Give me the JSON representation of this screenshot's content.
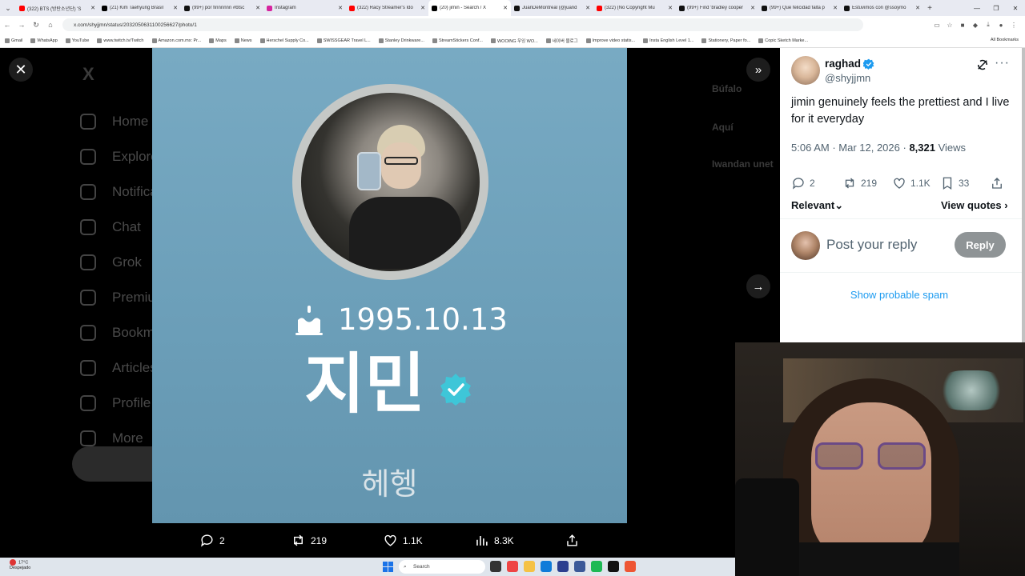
{
  "browser": {
    "tabs": [
      {
        "label": "(322) BTS (방탄소년단) 'S",
        "fav": "#ff0000",
        "active": false
      },
      {
        "label": "(21) Kim Taehyung Brasil",
        "fav": "#000000",
        "active": false
      },
      {
        "label": "(99+) por finnnnnn #btsc",
        "fav": "#111111",
        "active": false
      },
      {
        "label": "Instagram",
        "fav": "#d6249f",
        "active": false
      },
      {
        "label": "(322) Racy Streamer's Ido",
        "fav": "#ff0000",
        "active": false
      },
      {
        "label": "(20) jimin - Search / X",
        "fav": "#000000",
        "active": true
      },
      {
        "label": "JuanDeMontreal (@juand",
        "fav": "#111111",
        "active": false
      },
      {
        "label": "(322) (No Copyright Mu",
        "fav": "#ff0000",
        "active": false
      },
      {
        "label": "(99+) Find 'bradley cooper",
        "fav": "#111111",
        "active": false
      },
      {
        "label": "(99+) Que felicidad falta p",
        "fav": "#111111",
        "active": false
      },
      {
        "label": "Estuvimos con @ssoymo",
        "fav": "#111111",
        "active": false
      }
    ],
    "url": "x.com/shyjjmn/status/2032050631100256627/photo/1",
    "bookmarks": [
      "Gmail",
      "WhatsApp",
      "YouTube",
      "www.twitch.tv/Twitch",
      "Amazon.com.mx: Pr...",
      "Maps",
      "News",
      "Herschel Supply Co...",
      "SWISSGEAR Travel L...",
      "Stanley Drinkware...",
      "StreamStickers Conf...",
      "WOOING 우잉 WO...",
      "네이버 블로그",
      "Improve video statis...",
      "Insta English Level 1...",
      "Stationery, Paper fo...",
      "Copic Sketch Marke..."
    ],
    "all_bookmarks": "All Bookmarks"
  },
  "background_nav": [
    "Home",
    "Explore",
    "Notifications",
    "Chat",
    "Grok",
    "Premium",
    "Bookmarks",
    "Articles",
    "Profile",
    "More"
  ],
  "background_right": [
    "Búfalo",
    "Aquí",
    "Iwandan unet"
  ],
  "media": {
    "birthdate": "1995.10.13",
    "name_korean": "지민",
    "subtitle_korean": "헤헹",
    "accent": "#3ec6d8"
  },
  "media_bar": {
    "replies": "2",
    "reposts": "219",
    "likes": "1.1K",
    "views": "8.3K"
  },
  "tweet": {
    "display_name": "raghad",
    "handle": "@shyjjmn",
    "text": "jimin genuinely feels the prettiest and I live for it everyday",
    "time": "5:06 AM",
    "date": "Mar 12, 2026",
    "views_count": "8,321",
    "views_label": "Views",
    "replies": "2",
    "reposts": "219",
    "likes": "1.1K",
    "bookmarks": "33",
    "sort_label": "Relevant",
    "view_quotes": "View quotes",
    "reply_placeholder": "Post your reply",
    "reply_button": "Reply",
    "show_spam": "Show probable spam",
    "verified_color": "#1d9bf0"
  },
  "taskbar": {
    "temp": "17°C",
    "condition": "Despejado",
    "search": "Search"
  }
}
